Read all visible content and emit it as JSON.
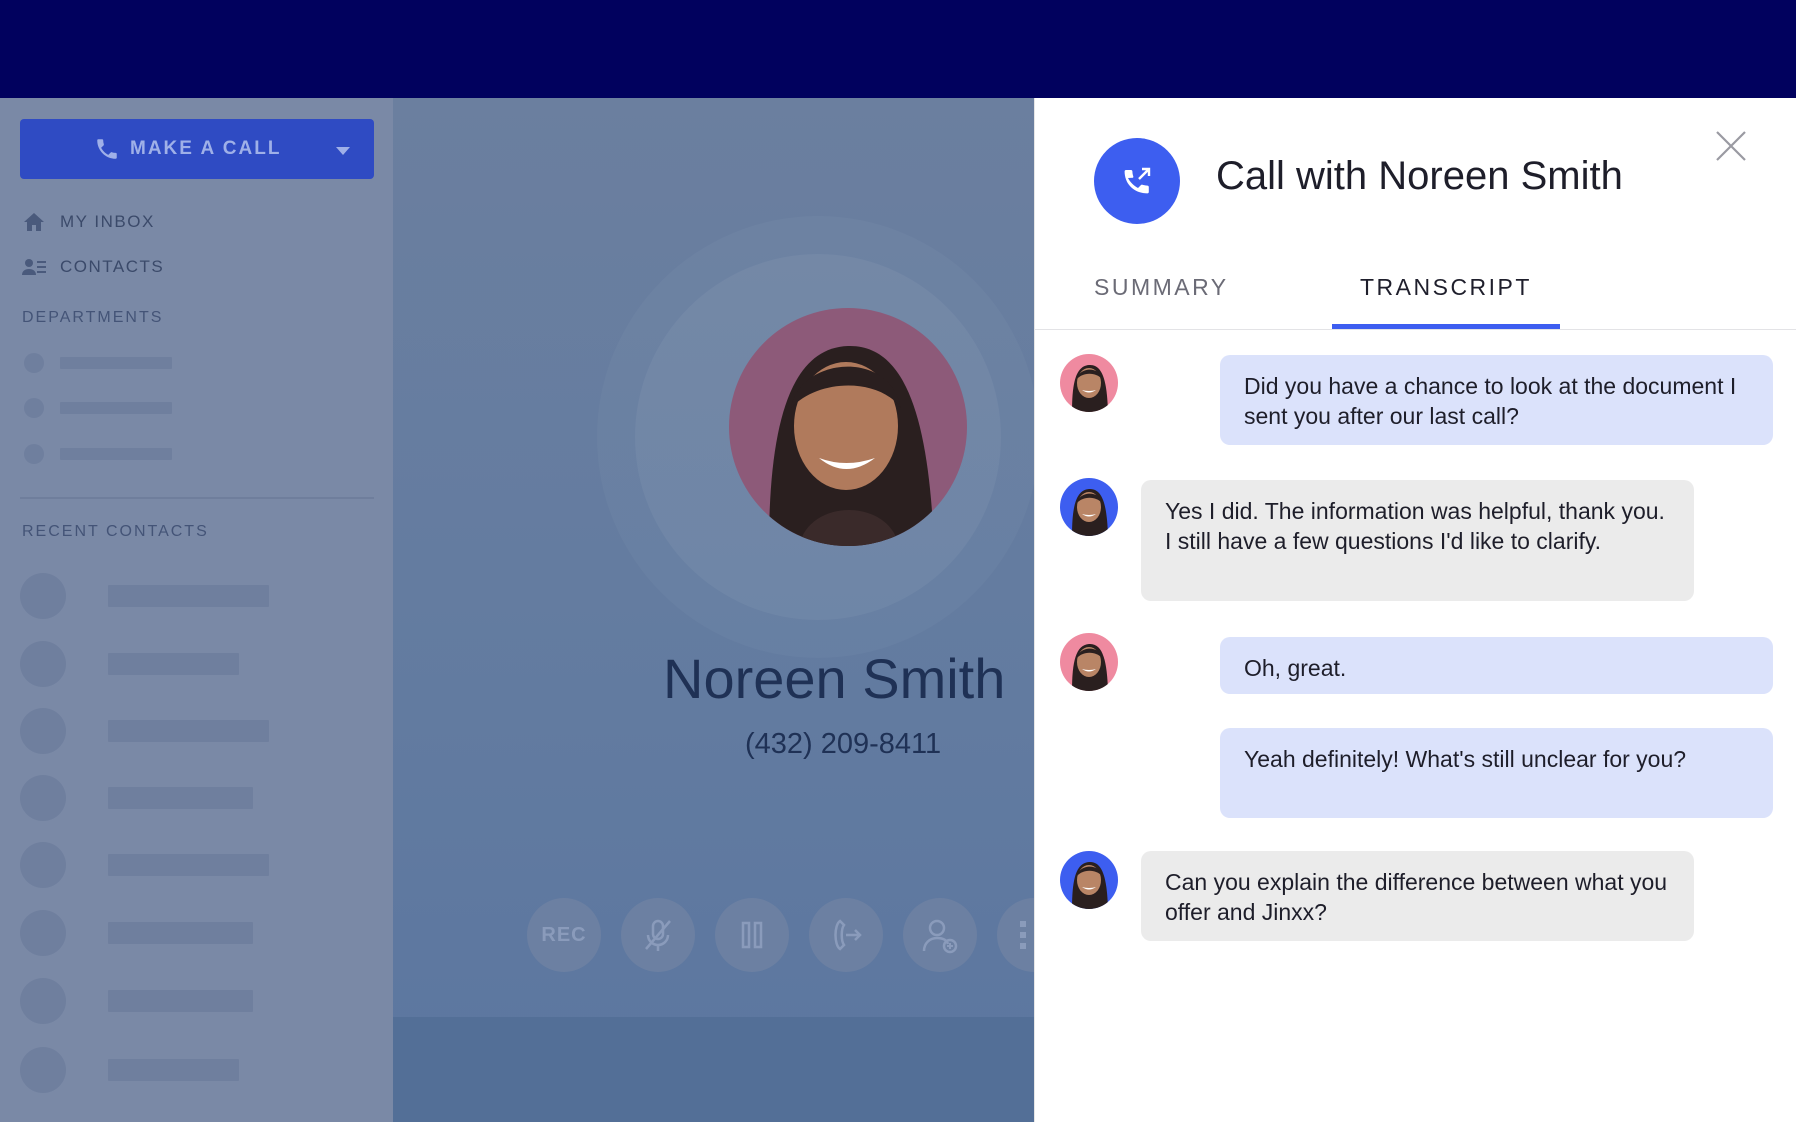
{
  "sidebar": {
    "make_call_label": "MAKE A CALL",
    "nav": [
      {
        "label": "MY INBOX",
        "icon": "home-icon"
      },
      {
        "label": "CONTACTS",
        "icon": "contacts-icon"
      }
    ],
    "departments_header": "DEPARTMENTS",
    "recent_contacts_header": "RECENT CONTACTS"
  },
  "call": {
    "contact_name": "Noreen Smith",
    "contact_phone": "(432) 209-8411",
    "controls": {
      "record_label": "REC"
    }
  },
  "panel": {
    "title": "Call with Noreen Smith",
    "tabs": [
      {
        "label": "SUMMARY",
        "active": false
      },
      {
        "label": "TRANSCRIPT",
        "active": true
      }
    ],
    "accent_color": "#3d5ef0",
    "messages": [
      {
        "speaker": "contact",
        "text": "Did you have a chance to look at the document I sent you after our last call?"
      },
      {
        "speaker": "agent",
        "text": "Yes I did. The information was helpful, thank you. I still have a few questions I'd like to clarify."
      },
      {
        "speaker": "contact",
        "text": "Oh, great."
      },
      {
        "speaker": "contact",
        "text": "Yeah definitely! What's still unclear for you?"
      },
      {
        "speaker": "agent",
        "text": "Can you explain the difference between what you offer and Jinxx?"
      }
    ]
  }
}
